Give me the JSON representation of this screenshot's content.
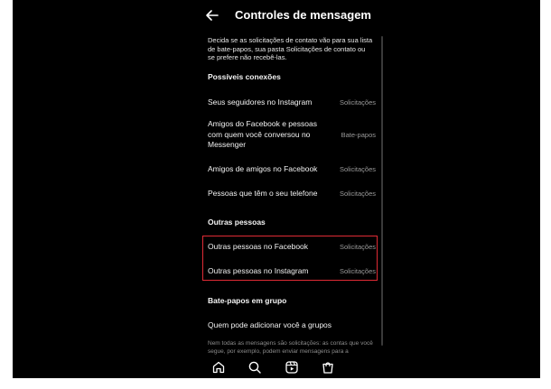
{
  "header": {
    "title": "Controles de mensagem",
    "back_icon": "arrow-left-icon"
  },
  "description": "Decida se as solicitações de contato vão para sua lista de bate-papos, sua pasta Solicitações de contato ou se prefere não recebê-las.",
  "sections": {
    "possible_connections": {
      "title": "Possíveis conexões",
      "rows": [
        {
          "label": "Seus seguidores no Instagram",
          "value": "Solicitações"
        },
        {
          "label": "Amigos do Facebook e pessoas com quem você conversou no Messenger",
          "value": "Bate-papos"
        },
        {
          "label": "Amigos de amigos no Facebook",
          "value": "Solicitações"
        },
        {
          "label": "Pessoas que têm o seu telefone",
          "value": "Solicitações"
        }
      ]
    },
    "other_people": {
      "title": "Outras pessoas",
      "rows": [
        {
          "label": "Outras pessoas no Facebook",
          "value": "Solicitações"
        },
        {
          "label": "Outras pessoas no Instagram",
          "value": "Solicitações"
        }
      ]
    },
    "group_chats": {
      "title": "Bate-papos em grupo",
      "rows": [
        {
          "label": "Quem pode adicionar você a grupos"
        }
      ]
    }
  },
  "footer_text": "Nem todas as mensagens são solicitações: as contas que você segue, por exemplo, podem enviar mensagens para a",
  "tabbar": {
    "icons": [
      "home-icon",
      "search-icon",
      "reels-icon",
      "shop-icon"
    ]
  },
  "colors": {
    "background": "#000000",
    "highlight": "#e02b35"
  }
}
